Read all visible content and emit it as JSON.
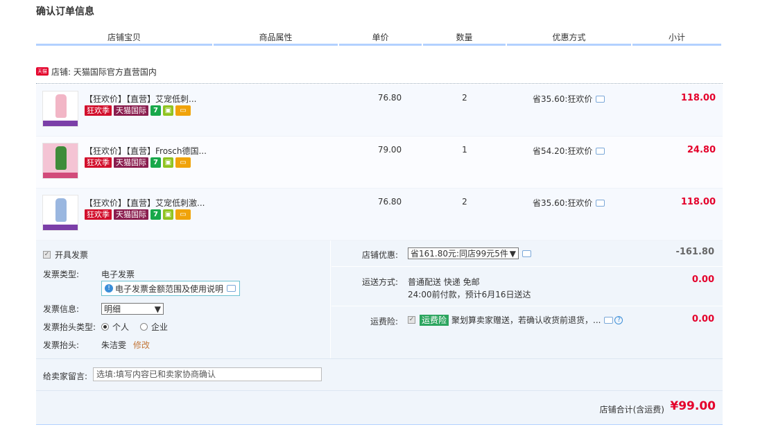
{
  "page": {
    "title": "确认订单信息"
  },
  "header": {
    "cols": [
      "店铺宝贝",
      "商品属性",
      "单价",
      "数量",
      "优惠方式",
      "小计"
    ]
  },
  "shop": {
    "logo_text": "天猫",
    "label": "店铺: 天猫国际官方直营国内"
  },
  "tags": {
    "kuanghuan": "狂欢季",
    "tmall_intl": "天猫国际",
    "seven_icon": "7"
  },
  "items": [
    {
      "name": "【狂欢价】【直营】艾宠低刺...",
      "price": "76.80",
      "qty": "2",
      "promo": "省35.60:狂欢价",
      "subtotal": "118.00",
      "thumb_color": "#f2b6c6"
    },
    {
      "name": "【狂欢价】【直营】Frosch德国...",
      "price": "79.00",
      "qty": "1",
      "promo": "省54.20:狂欢价",
      "subtotal": "24.80",
      "thumb_color": "#3f8c3a"
    },
    {
      "name": "【狂欢价】【直营】艾宠低刺激...",
      "price": "76.80",
      "qty": "2",
      "promo": "省35.60:狂欢价",
      "subtotal": "118.00",
      "thumb_color": "#9ab7e0"
    }
  ],
  "invoice": {
    "open_label": "开具发票",
    "type_label": "发票类型:",
    "type_value": "电子发票",
    "notice": "电子发票金额范围及使用说明",
    "info_label": "发票信息:",
    "info_value": "明细",
    "header_type_label": "发票抬头类型:",
    "personal": "个人",
    "company": "企业",
    "header_label": "发票抬头:",
    "header_value": "朱洁雯",
    "modify": "修改"
  },
  "summary": {
    "discount_label": "店铺优惠:",
    "discount_option": "省161.80元:同店99元5件",
    "discount_amount": "-161.80",
    "ship_label": "运送方式:",
    "ship_value": "普通配送 快递 免邮",
    "ship_note": "24:00前付款，预计6月16日送达",
    "ship_amount": "0.00",
    "ins_label": "运费险:",
    "ins_badge": "运费险",
    "ins_text": "聚划算卖家赠送，若确认收货前退货，...",
    "ins_amount": "0.00"
  },
  "message": {
    "label": "给卖家留言:",
    "placeholder": "选填:填写内容已和卖家协商确认"
  },
  "total": {
    "label": "店铺合计(含运费)",
    "value": "¥99.00"
  }
}
